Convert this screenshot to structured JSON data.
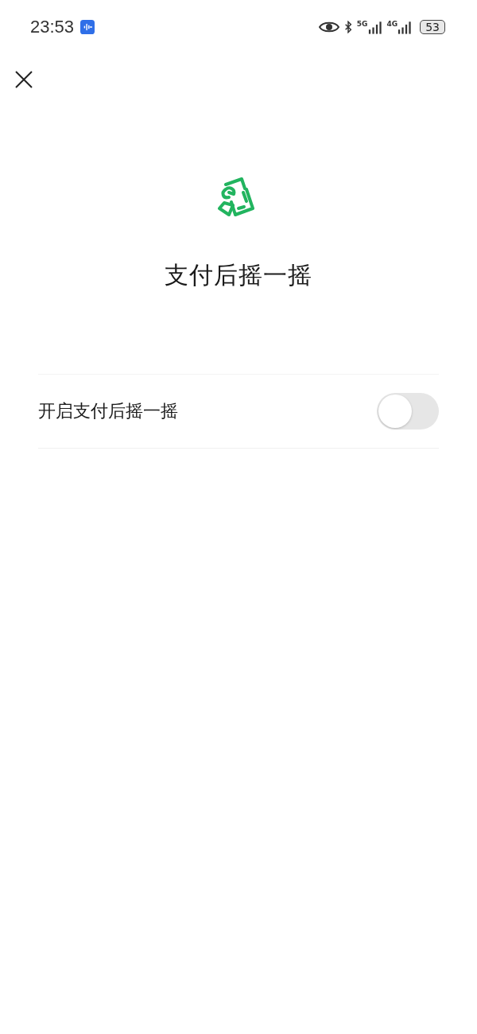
{
  "status_bar": {
    "time": "23:53",
    "networks": [
      {
        "label": "5G"
      },
      {
        "label": "4G"
      }
    ],
    "battery": "53"
  },
  "title": "支付后摇一摇",
  "settings": [
    {
      "kind": "toggle",
      "label": "开启支付后摇一摇",
      "on": false
    }
  ]
}
